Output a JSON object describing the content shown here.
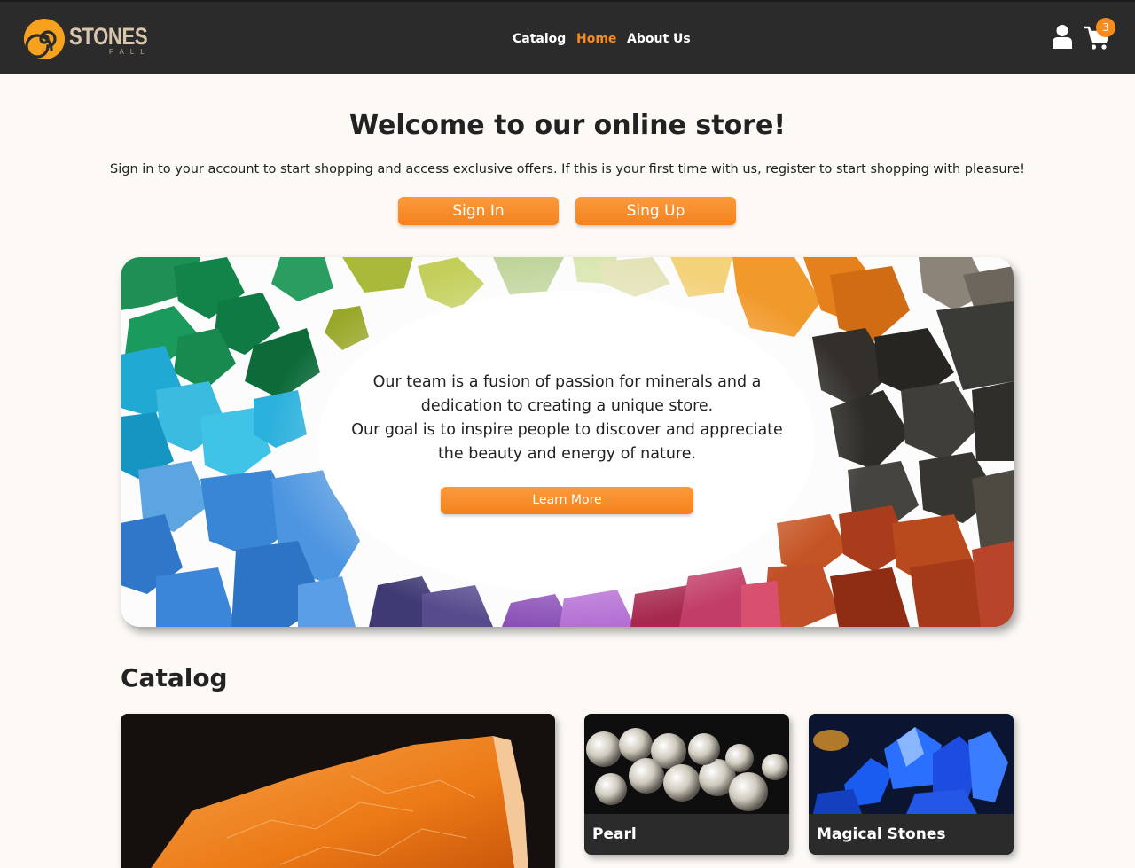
{
  "brand": {
    "name": "STONES",
    "sub": "FALL"
  },
  "nav": [
    {
      "label": "Catalog",
      "active": false
    },
    {
      "label": "Home",
      "active": true
    },
    {
      "label": "About Us",
      "active": false
    }
  ],
  "cart": {
    "count": "3"
  },
  "welcome": {
    "title": "Welcome to our online store!",
    "text": "Sign in to your account to start shopping and access exclusive offers. If this is your first time with us, register to start shopping with pleasure!",
    "signin_label": "Sign In",
    "signup_label": "Sing Up"
  },
  "hero": {
    "line1": "Our team is a fusion of passion for minerals and a dedication to creating a unique store.",
    "line2": "Our goal is to inspire people to discover and appreciate the beauty and energy of nature.",
    "button_label": "Learn More"
  },
  "catalog": {
    "title": "Catalog",
    "cards": [
      {
        "label": ""
      },
      {
        "label": "Pearl"
      },
      {
        "label": "Magical Stones"
      }
    ]
  },
  "colors": {
    "accent": "#f68b1f",
    "header_bg": "#2b2b2b",
    "page_bg": "#fdfaf6"
  }
}
